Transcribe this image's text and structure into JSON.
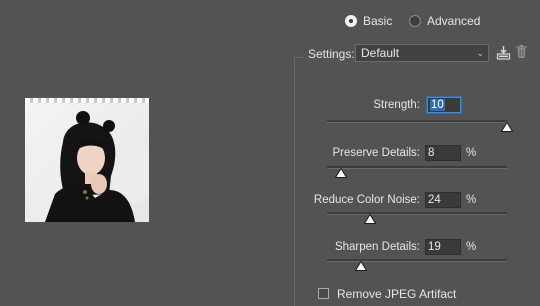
{
  "mode": {
    "basic_label": "Basic",
    "advanced_label": "Advanced",
    "selected": "Basic"
  },
  "settings": {
    "label": "Settings:",
    "value": "Default"
  },
  "controls": {
    "strength": {
      "label": "Strength:",
      "value": "10",
      "unit": "",
      "slider_fraction": 1.0
    },
    "preserve_details": {
      "label": "Preserve Details:",
      "value": "8",
      "unit": "%",
      "slider_fraction": 0.08
    },
    "reduce_color_noise": {
      "label": "Reduce Color Noise:",
      "value": "24",
      "unit": "%",
      "slider_fraction": 0.24
    },
    "sharpen_details": {
      "label": "Sharpen Details:",
      "value": "19",
      "unit": "%",
      "slider_fraction": 0.19
    }
  },
  "remove_jpeg_artifact": {
    "label": "Remove JPEG Artifact",
    "checked": false
  },
  "icons": {
    "save": "save-preset-icon",
    "delete": "trash-icon",
    "dropdown": "chevron-down-icon"
  },
  "colors": {
    "background": "#535353",
    "focus": "#3b8fd8"
  }
}
